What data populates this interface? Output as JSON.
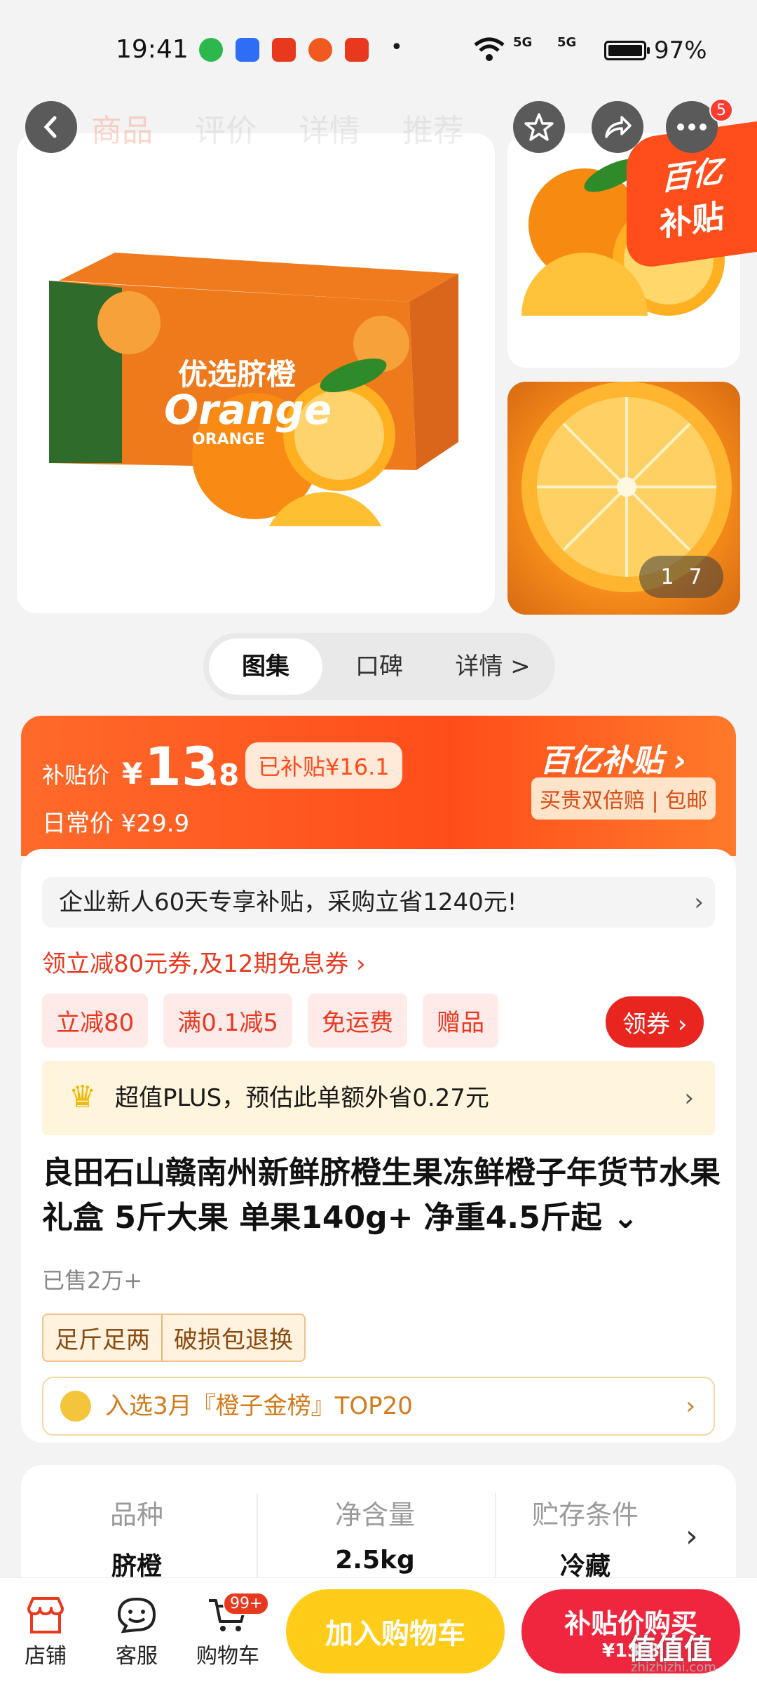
{
  "status": {
    "time": "19:41",
    "battery": "97%",
    "signal1": "5G",
    "signal2": "5G"
  },
  "nav": {
    "tabs": [
      "商品",
      "评价",
      "详情",
      "推荐"
    ],
    "more_badge": "5"
  },
  "gallery": {
    "box_text": "优选脐橙",
    "box_sub": "Orange",
    "box_label": "ORANGE",
    "subsidy_tag_l1": "百亿",
    "subsidy_tag_l2": "补贴",
    "counter_current": "1",
    "counter_total": "7"
  },
  "segments": [
    "图集",
    "口碑",
    "详情 >"
  ],
  "price": {
    "label": "补贴价",
    "yen": "¥",
    "integer": "13",
    "decimal": ".8",
    "subsidized": "已补贴¥16.1",
    "regular": "日常价 ¥29.9",
    "brand": "百亿补贴 ›",
    "brand_sub": "买贵双倍赔 | 包邮"
  },
  "promo": {
    "bar_text": "企业新人60天专享补贴，采购立省1240元!",
    "coupon_link": "领立减80元券,及12期免息券 ›",
    "chips": [
      "立减80",
      "满0.1减5",
      "免运费",
      "赠品"
    ],
    "get_coupon": "领券 ›",
    "plus_text": "超值PLUS，预估此单额外省0.27元"
  },
  "product": {
    "title": "良田石山赣南州新鲜脐橙生果冻鲜橙子年货节水果礼盒 5斤大果 单果140g+ 净重4.5斤起 ⌄",
    "sold": "已售2万+",
    "tags": [
      "足斤足两",
      "破损包退换"
    ],
    "rank": "入选3月『橙子金榜』TOP20"
  },
  "specs": [
    {
      "key": "品种",
      "value": "脐橙"
    },
    {
      "key": "净含量",
      "value": "2.5kg"
    },
    {
      "key": "贮存条件",
      "value": "冷藏"
    }
  ],
  "bottom": {
    "store": "店铺",
    "service": "客服",
    "cart": "购物车",
    "cart_badge": "99+",
    "add_cart": "加入购物车",
    "buy_now": "补贴价购买",
    "buy_price": "¥13.8"
  },
  "watermark": {
    "main": "值值值",
    "sub": "zhizhizhi.com"
  }
}
